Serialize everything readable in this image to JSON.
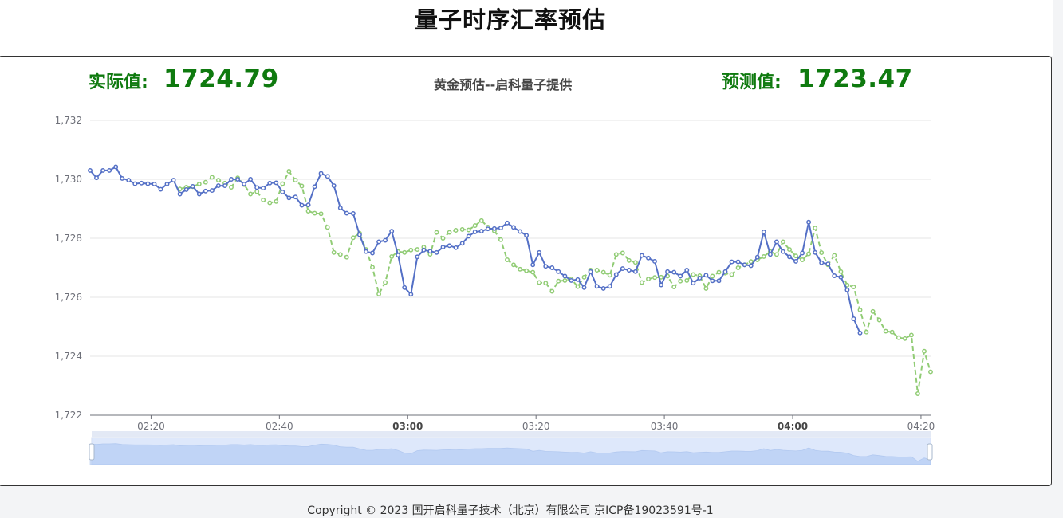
{
  "page": {
    "title": "量子时序汇率预估",
    "footer": "Copyright © 2023 国开启科量子技术（北京）有限公司 京ICP备19023591号-1"
  },
  "header": {
    "actual_label": "实际值:",
    "actual_value": "1724.79",
    "predicted_label": "预测值:",
    "predicted_value": "1723.47"
  },
  "colors": {
    "actual": "#5470c6",
    "predicted": "#91cc75",
    "accent_text": "#0f7a0f"
  },
  "chart_data": {
    "type": "line",
    "title": "黄金预估--启科量子提供",
    "ylim": [
      1722,
      1732
    ],
    "yticks": [
      "1,722",
      "1,724",
      "1,726",
      "1,728",
      "1,730",
      "1,732"
    ],
    "ytick_values": [
      1722,
      1724,
      1726,
      1728,
      1730,
      1732
    ],
    "xticks": [
      {
        "label": "02:20",
        "t": 9.5,
        "bold": false
      },
      {
        "label": "02:40",
        "t": 29.5,
        "bold": false
      },
      {
        "label": "03:00",
        "t": 49.5,
        "bold": true
      },
      {
        "label": "03:20",
        "t": 69.5,
        "bold": false
      },
      {
        "label": "03:40",
        "t": 89.5,
        "bold": false
      },
      {
        "label": "04:00",
        "t": 109.5,
        "bold": true
      },
      {
        "label": "04:20",
        "t": 129.5,
        "bold": false
      }
    ],
    "x_range": [
      0,
      131
    ],
    "grid": true,
    "dataZoom": true,
    "series": [
      {
        "name": "实际值",
        "style": "solid",
        "values": [
          1730.3,
          1730.05,
          1730.3,
          1730.3,
          1730.42,
          1730.03,
          1729.97,
          1729.85,
          1729.87,
          1729.85,
          1729.84,
          1729.66,
          1729.84,
          1729.97,
          1729.5,
          1729.65,
          1729.76,
          1729.5,
          1729.6,
          1729.62,
          1729.78,
          1729.78,
          1730.0,
          1730.0,
          1729.84,
          1730.0,
          1729.72,
          1729.7,
          1729.87,
          1729.88,
          1729.57,
          1729.37,
          1729.4,
          1729.12,
          1729.13,
          1729.75,
          1730.2,
          1730.1,
          1729.78,
          1729.03,
          1728.85,
          1728.84,
          1728.12,
          1727.55,
          1727.5,
          1727.88,
          1727.93,
          1728.24,
          1727.43,
          1726.33,
          1726.1,
          1727.37,
          1727.6,
          1727.56,
          1727.52,
          1727.7,
          1727.75,
          1727.68,
          1727.83,
          1728.07,
          1728.22,
          1728.24,
          1728.32,
          1728.33,
          1728.35,
          1728.52,
          1728.37,
          1728.23,
          1728.1,
          1727.1,
          1727.52,
          1727.05,
          1727.0,
          1726.87,
          1726.72,
          1726.57,
          1726.6,
          1726.33,
          1726.87,
          1726.37,
          1726.3,
          1726.37,
          1726.77,
          1726.97,
          1726.92,
          1726.87,
          1727.42,
          1727.33,
          1727.22,
          1726.42,
          1726.87,
          1726.85,
          1726.72,
          1726.92,
          1726.48,
          1726.65,
          1726.75,
          1726.56,
          1726.56,
          1726.87,
          1727.2,
          1727.2,
          1727.1,
          1727.07,
          1727.36,
          1728.22,
          1727.45,
          1727.88,
          1727.55,
          1727.37,
          1727.22,
          1727.5,
          1728.55,
          1727.52,
          1727.17,
          1727.13,
          1726.73,
          1726.68,
          1726.25,
          1725.27,
          1724.79
        ],
        "x_start": 0
      },
      {
        "name": "预测值",
        "style": "dashed",
        "values": [
          1729.67,
          1729.73,
          1729.75,
          1729.84,
          1729.9,
          1730.07,
          1729.97,
          1729.87,
          1729.73,
          1730.05,
          1729.82,
          1729.5,
          1729.58,
          1729.3,
          1729.2,
          1729.25,
          1729.85,
          1730.27,
          1729.97,
          1729.77,
          1728.92,
          1728.85,
          1728.83,
          1728.37,
          1727.52,
          1727.45,
          1727.36,
          1728.02,
          1728.17,
          1727.62,
          1727.02,
          1726.11,
          1726.5,
          1727.38,
          1727.55,
          1727.52,
          1727.6,
          1727.62,
          1727.7,
          1727.46,
          1728.2,
          1728.0,
          1728.2,
          1728.27,
          1728.3,
          1728.28,
          1728.43,
          1728.6,
          1728.38,
          1728.25,
          1727.95,
          1727.27,
          1727.1,
          1726.95,
          1726.9,
          1726.85,
          1726.5,
          1726.48,
          1726.2,
          1726.55,
          1726.57,
          1726.62,
          1726.36,
          1726.68,
          1726.92,
          1726.92,
          1726.85,
          1726.75,
          1727.45,
          1727.5,
          1727.25,
          1727.18,
          1726.5,
          1726.62,
          1726.67,
          1726.68,
          1726.72,
          1726.35,
          1726.55,
          1726.57,
          1726.77,
          1726.73,
          1726.3,
          1726.72,
          1726.85,
          1726.82,
          1726.77,
          1727.0,
          1727.1,
          1727.21,
          1727.27,
          1727.38,
          1727.55,
          1727.45,
          1727.88,
          1727.62,
          1727.4,
          1727.27,
          1727.47,
          1728.35,
          1727.51,
          1727.1,
          1727.42,
          1726.87,
          1726.41,
          1726.35,
          1725.57,
          1724.82,
          1725.52,
          1725.23,
          1724.85,
          1724.82,
          1724.63,
          1724.6,
          1724.72,
          1722.73,
          1724.17,
          1723.47
        ],
        "x_start": 14
      }
    ]
  }
}
